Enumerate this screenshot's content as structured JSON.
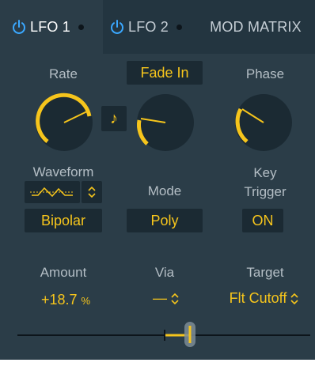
{
  "tabs": [
    {
      "label": "LFO 1",
      "icon": "power-icon",
      "active": true
    },
    {
      "label": "LFO 2",
      "icon": "power-icon",
      "active": false
    },
    {
      "label": "MOD MATRIX",
      "active": false
    }
  ],
  "rate": {
    "label": "Rate",
    "sync_icon": "eighth-note-icon",
    "level": 0.6
  },
  "fade": {
    "label": "Fade In",
    "level": 0.35
  },
  "phase": {
    "label": "Phase",
    "level": 0.3
  },
  "waveform": {
    "label": "Waveform",
    "shape_icon": "waveform-shape-icon",
    "stepper_icon": "up-down-chevron-icon",
    "value": "Bipolar"
  },
  "mode": {
    "label": "Mode",
    "value": "Poly"
  },
  "key_trigger": {
    "label_line1": "Key",
    "label_line2": "Trigger",
    "value": "ON"
  },
  "amount": {
    "label": "Amount",
    "value": "+18.7",
    "unit": "%"
  },
  "via": {
    "label": "Via",
    "value": "—"
  },
  "target": {
    "label": "Target",
    "value": "Flt Cutoff"
  },
  "colors": {
    "accent": "#f6c51c",
    "panel": "#2b3d48",
    "tab_bar": "#233540",
    "box": "#1b2a33",
    "active_tab_icon": "#3aa8ff"
  }
}
